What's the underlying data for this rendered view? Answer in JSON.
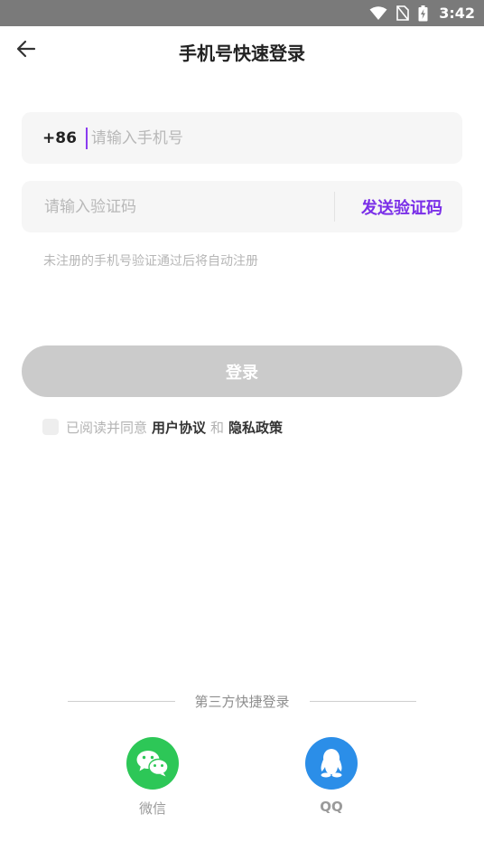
{
  "status_bar": {
    "time": "3:42",
    "icons": [
      "wifi-icon",
      "no-sim-icon",
      "battery-charging-icon"
    ]
  },
  "header": {
    "title": "手机号快速登录",
    "back_icon": "arrow-left-icon"
  },
  "phone": {
    "country_code": "+86",
    "placeholder": "请输入手机号",
    "value": ""
  },
  "verification": {
    "placeholder": "请输入验证码",
    "value": "",
    "send_label": "发送验证码"
  },
  "hint": "未注册的手机号验证通过后将自动注册",
  "login_label": "登录",
  "agreement": {
    "checked": false,
    "prefix": "已阅读并同意",
    "user_agreement": "用户协议",
    "and": "和",
    "privacy_policy": "隐私政策"
  },
  "third_party": {
    "title": "第三方快捷登录",
    "options": [
      {
        "label": "微信",
        "icon": "wechat-icon"
      },
      {
        "label": "QQ",
        "icon": "qq-icon"
      }
    ]
  },
  "colors": {
    "accent": "#7a2fe8",
    "login_disabled": "#cbcbcb",
    "wechat": "#2dc757",
    "qq": "#2b8ee8",
    "field_bg": "#f6f6f6"
  }
}
